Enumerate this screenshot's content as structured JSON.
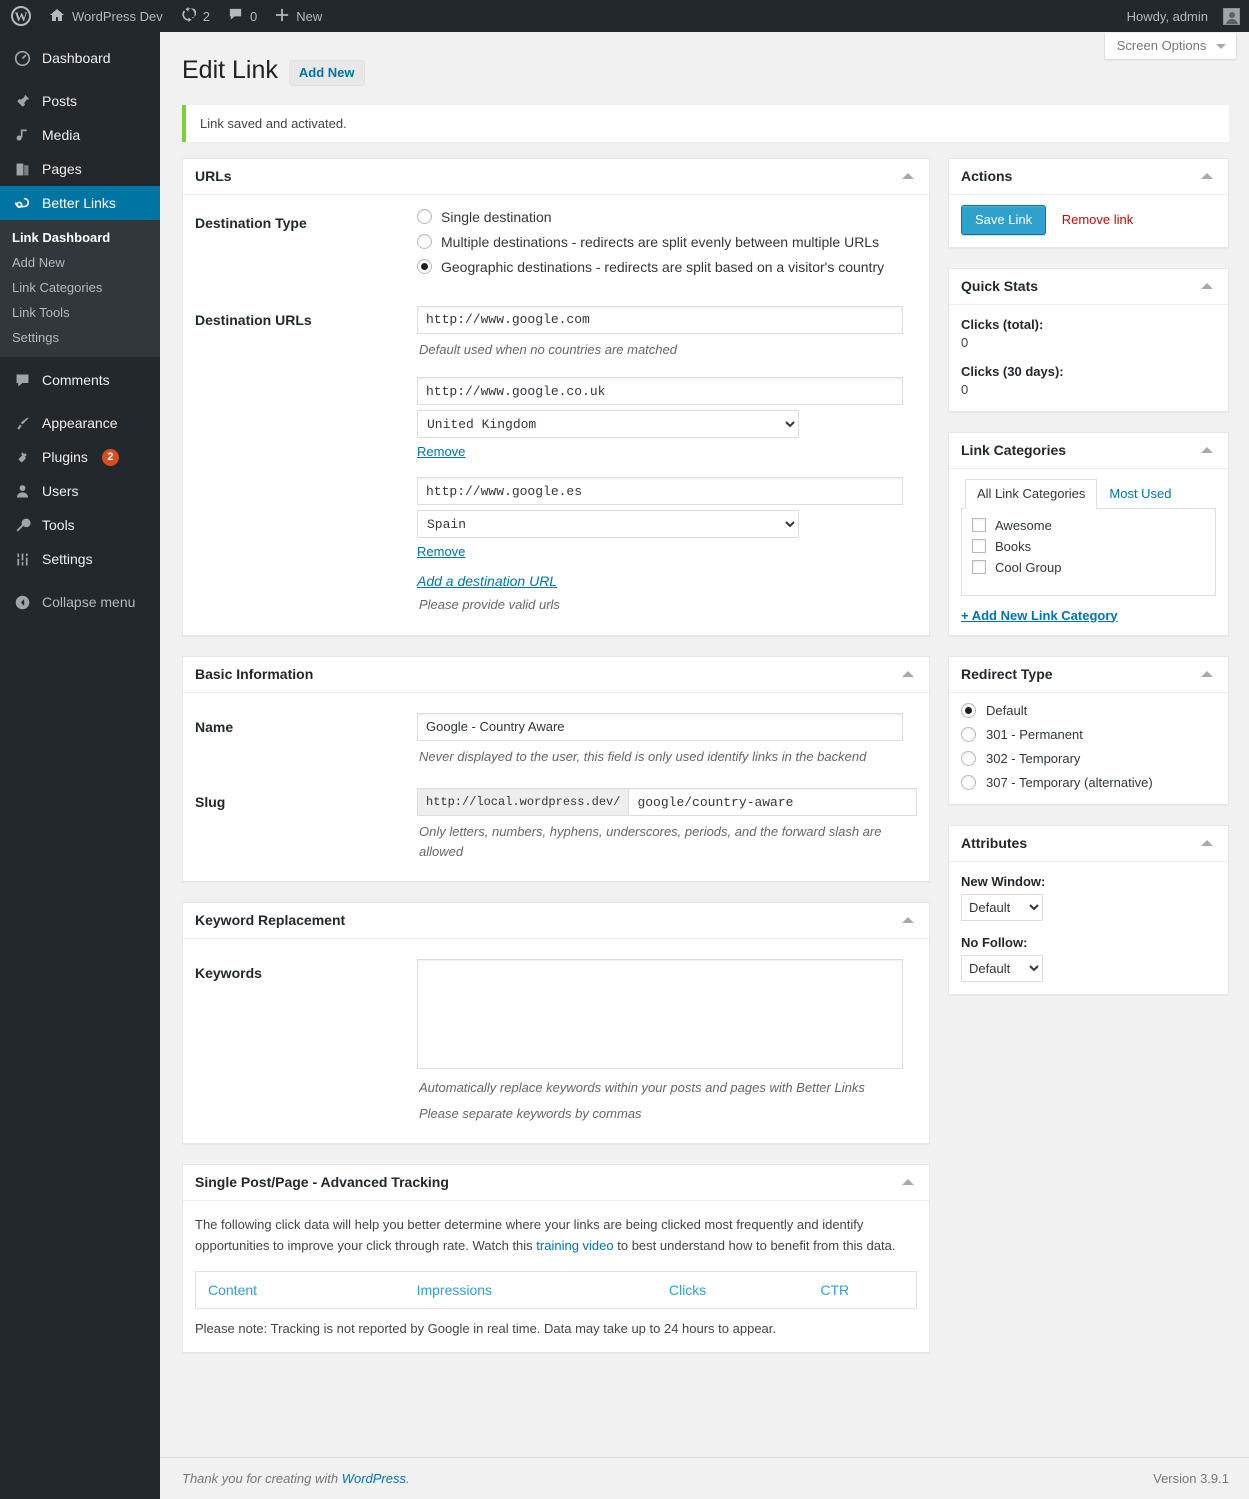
{
  "adminbar": {
    "logo_icon": "wordpress-logo-icon",
    "site_name": "WordPress Dev",
    "updates_count": "2",
    "comments_count": "0",
    "new_label": "New",
    "howdy": "Howdy, admin"
  },
  "sidebar": {
    "items": [
      {
        "label": "Dashboard",
        "icon": "dashboard-icon"
      },
      {
        "label": "Posts",
        "icon": "pin-icon"
      },
      {
        "label": "Media",
        "icon": "media-icon"
      },
      {
        "label": "Pages",
        "icon": "pages-icon"
      },
      {
        "label": "Better Links",
        "icon": "link-icon",
        "current": true
      },
      {
        "label": "Comments",
        "icon": "comment-icon"
      },
      {
        "label": "Appearance",
        "icon": "brush-icon"
      },
      {
        "label": "Plugins",
        "icon": "plug-icon",
        "badge": "2"
      },
      {
        "label": "Users",
        "icon": "user-icon"
      },
      {
        "label": "Tools",
        "icon": "wrench-icon"
      },
      {
        "label": "Settings",
        "icon": "sliders-icon"
      },
      {
        "label": "Collapse menu",
        "icon": "collapse-icon"
      }
    ],
    "submenu": [
      {
        "label": "Link Dashboard",
        "active": true
      },
      {
        "label": "Add New"
      },
      {
        "label": "Link Categories"
      },
      {
        "label": "Link Tools"
      },
      {
        "label": "Settings"
      }
    ]
  },
  "screen_options": {
    "label": "Screen Options"
  },
  "header": {
    "title": "Edit Link",
    "add_new": "Add New",
    "notice": "Link saved and activated."
  },
  "urls_box": {
    "title": "URLs",
    "destination_type_label": "Destination Type",
    "options": [
      {
        "label": "Single destination",
        "selected": false
      },
      {
        "label": "Multiple destinations - redirects are split evenly between multiple URLs",
        "selected": false
      },
      {
        "label": "Geographic destinations - redirects are split based on a visitor's country",
        "selected": true
      }
    ],
    "destination_urls_label": "Destination URLs",
    "default_url": "http://www.google.com",
    "default_hint": "Default used when no countries are matched",
    "geo_rows": [
      {
        "url": "http://www.google.co.uk",
        "country": "United Kingdom",
        "remove_label": "Remove"
      },
      {
        "url": "http://www.google.es",
        "country": "Spain",
        "remove_label": "Remove"
      }
    ],
    "add_destination_label": "Add a destination URL",
    "valid_urls_hint": "Please provide valid urls"
  },
  "basic_box": {
    "title": "Basic Information",
    "name_label": "Name",
    "name_value": "Google - Country Aware",
    "name_hint": "Never displayed to the user, this field is only used identify links in the backend",
    "slug_label": "Slug",
    "slug_prefix": "http://local.wordpress.dev/",
    "slug_value": "google/country-aware",
    "slug_hint": "Only letters, numbers, hyphens, underscores, periods, and the forward slash are allowed"
  },
  "keyword_box": {
    "title": "Keyword Replacement",
    "keywords_label": "Keywords",
    "keywords_value": "",
    "hint1": "Automatically replace keywords within your posts and pages with Better Links",
    "hint2": "Please separate keywords by commas"
  },
  "tracking_box": {
    "title": "Single Post/Page - Advanced Tracking",
    "para_before": "The following click data will help you better determine where your links are being clicked most frequently and identify opportunities to improve your click through rate. Watch this ",
    "link_text": "training video",
    "para_after": " to best understand how to benefit from this data.",
    "columns": [
      "Content",
      "Impressions",
      "Clicks",
      "CTR"
    ],
    "note": "Please note: Tracking is not reported by Google in real time. Data may take up to 24 hours to appear."
  },
  "actions_box": {
    "title": "Actions",
    "save_label": "Save Link",
    "remove_label": "Remove link"
  },
  "quick_stats_box": {
    "title": "Quick Stats",
    "total_label": "Clicks (total):",
    "total_value": "0",
    "days30_label": "Clicks (30 days):",
    "days30_value": "0"
  },
  "link_categories_box": {
    "title": "Link Categories",
    "tabs": [
      {
        "label": "All Link Categories",
        "active": true
      },
      {
        "label": "Most Used",
        "active": false
      }
    ],
    "categories": [
      {
        "label": "Awesome",
        "checked": false
      },
      {
        "label": "Books",
        "checked": false
      },
      {
        "label": "Cool Group",
        "checked": false
      }
    ],
    "add_new_label": "+ Add New Link Category"
  },
  "redirect_type_box": {
    "title": "Redirect Type",
    "options": [
      {
        "label": "Default",
        "selected": true
      },
      {
        "label": "301 - Permanent",
        "selected": false
      },
      {
        "label": "302 - Temporary",
        "selected": false
      },
      {
        "label": "307 - Temporary (alternative)",
        "selected": false
      }
    ]
  },
  "attributes_box": {
    "title": "Attributes",
    "new_window_label": "New Window:",
    "new_window_value": "Default",
    "no_follow_label": "No Follow:",
    "no_follow_value": "Default"
  },
  "footer": {
    "thanks_prefix": "Thank you for creating with ",
    "wordpress_link": "WordPress",
    "thanks_suffix": ".",
    "version": "Version 3.9.1"
  },
  "colors": {
    "accent": "#0074a2",
    "primary_button": "#2ea2cc",
    "notice_green": "#7ad03a",
    "danger": "#bc0b0b",
    "badge": "#d54e21"
  }
}
